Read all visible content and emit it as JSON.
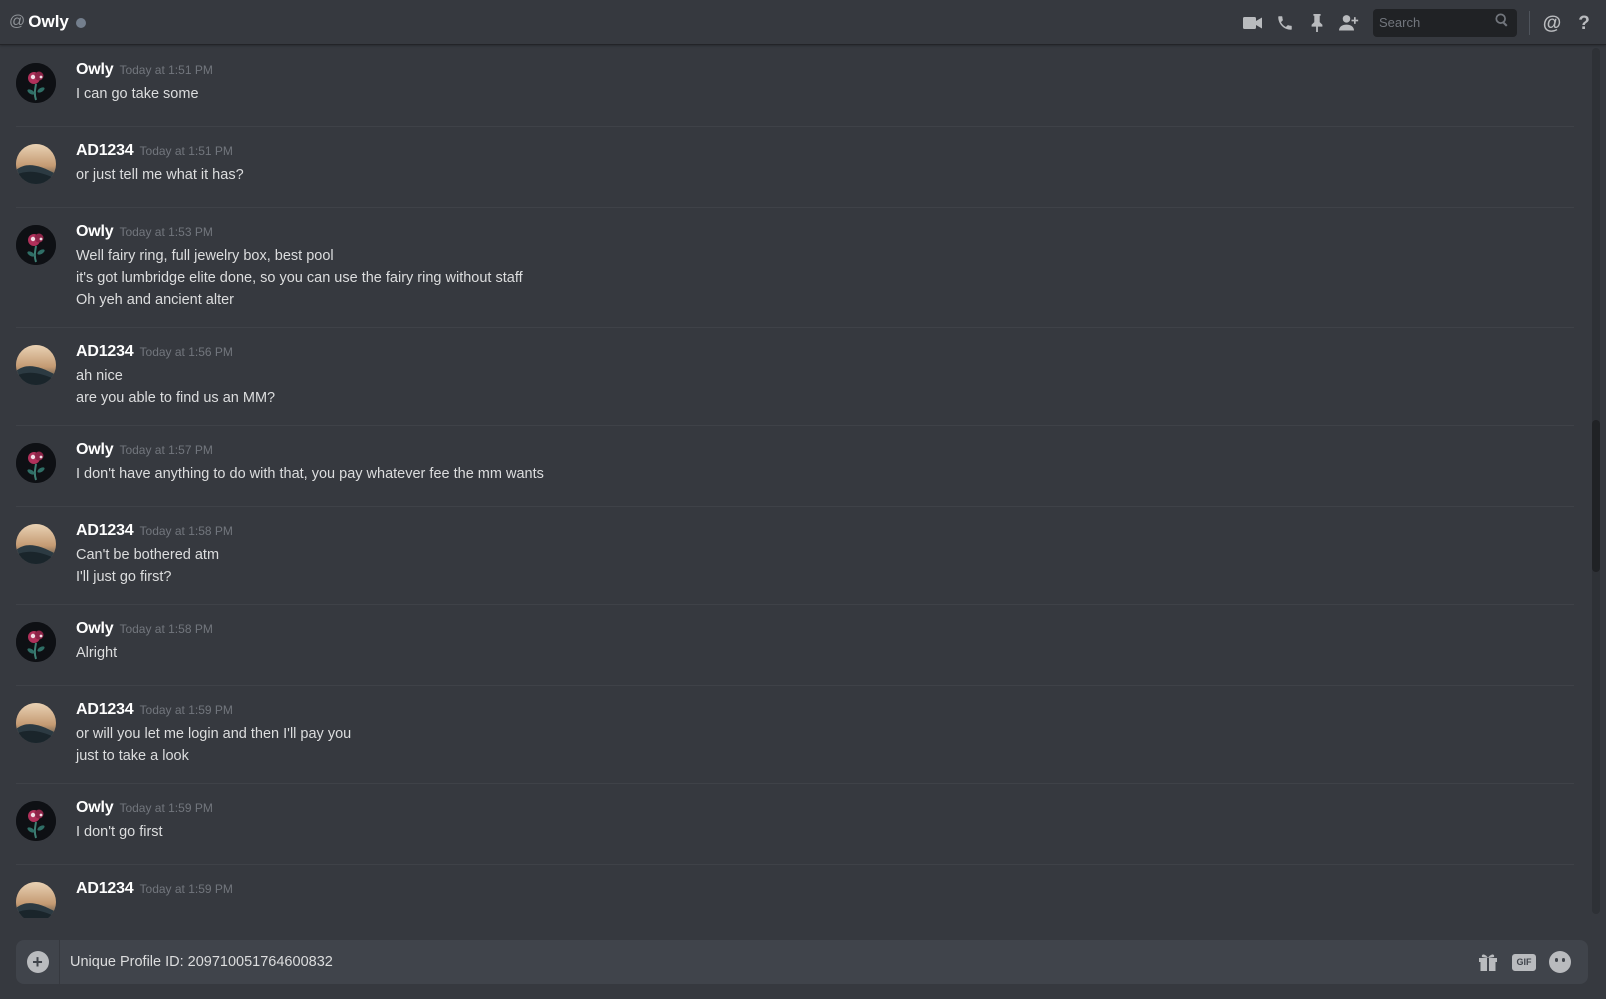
{
  "header": {
    "at_symbol": "@",
    "title": "Owly",
    "search_placeholder": "Search"
  },
  "icons": {
    "video": "video-camera-icon",
    "call": "phone-icon",
    "pin": "pin-icon",
    "add_friend": "add-user-icon",
    "search": "search-icon",
    "mentions": "at-mention-icon",
    "help": "help-icon",
    "attach": "plus-circle-icon",
    "gift": "gift-icon",
    "gif": "gif-icon",
    "emoji": "emoji-icon"
  },
  "colors": {
    "background": "#36393f",
    "composer": "#40444b",
    "username": "#ffffff",
    "timestamp": "#72767d",
    "text": "#dcddde"
  },
  "messages": [
    {
      "author": "Owly",
      "time": "Today at 1:51 PM",
      "lines": [
        "I can go take some"
      ]
    },
    {
      "author": "AD1234",
      "time": "Today at 1:51 PM",
      "lines": [
        "or just tell me what it has?"
      ]
    },
    {
      "author": "Owly",
      "time": "Today at 1:53 PM",
      "lines": [
        "Well fairy ring, full jewelry box, best pool",
        "it's got lumbridge elite done, so you can use the fairy ring without staff",
        "Oh yeh and ancient alter"
      ]
    },
    {
      "author": "AD1234",
      "time": "Today at 1:56 PM",
      "lines": [
        "ah nice",
        "are you able to find us an MM?"
      ]
    },
    {
      "author": "Owly",
      "time": "Today at 1:57 PM",
      "lines": [
        "I don't have anything to do with that, you pay whatever fee the mm wants"
      ]
    },
    {
      "author": "AD1234",
      "time": "Today at 1:58 PM",
      "lines": [
        "Can't be bothered atm",
        "I'll just go first?"
      ]
    },
    {
      "author": "Owly",
      "time": "Today at 1:58 PM",
      "lines": [
        "Alright"
      ]
    },
    {
      "author": "AD1234",
      "time": "Today at 1:59 PM",
      "lines": [
        "or will you let me login and then I'll pay you",
        "just to take a look"
      ]
    },
    {
      "author": "Owly",
      "time": "Today at 1:59 PM",
      "lines": [
        "I don't go first"
      ]
    },
    {
      "author": "AD1234",
      "time": "Today at 1:59 PM",
      "lines": []
    }
  ],
  "composer": {
    "value": "Unique Profile ID: 209710051764600832",
    "gif_label": "GIF"
  }
}
